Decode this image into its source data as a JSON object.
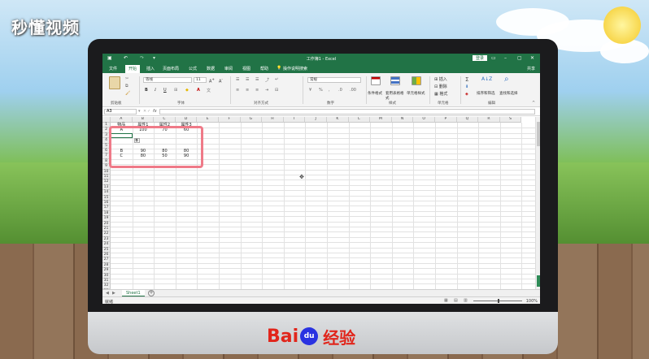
{
  "watermark": "秒懂视频",
  "brand": {
    "bai": "Bai",
    "du": "du",
    "jingyan": "经验"
  },
  "window": {
    "title": "工作簿1 - Excel",
    "login": "登录",
    "share": "共享"
  },
  "tabs": [
    {
      "label": "文件"
    },
    {
      "label": "开始",
      "active": true
    },
    {
      "label": "插入"
    },
    {
      "label": "页面布局"
    },
    {
      "label": "公式"
    },
    {
      "label": "数据"
    },
    {
      "label": "审阅"
    },
    {
      "label": "视图"
    },
    {
      "label": "帮助"
    },
    {
      "label": "操作说明搜索"
    }
  ],
  "ribbon": {
    "font_name": "等线",
    "font_size": "11",
    "number_format": "常规",
    "groups": {
      "clipboard": "剪贴板",
      "font": "字体",
      "alignment": "对齐方式",
      "number": "数字",
      "styles": "样式",
      "cells": "单元格",
      "editing": "编辑"
    },
    "buttons": {
      "conditional_format": "条件格式",
      "table_format": "套用表格格式",
      "cell_styles": "单元格样式",
      "insert": "插入",
      "delete": "删除",
      "format": "格式",
      "sort_filter": "排序和筛选",
      "find_select": "查找和选择"
    }
  },
  "formula_bar": {
    "name_box": "A3",
    "fx": "fx"
  },
  "columns": [
    "A",
    "B",
    "C",
    "D",
    "E",
    "F",
    "G",
    "H",
    "I",
    "J",
    "K",
    "L",
    "M",
    "N",
    "O",
    "P",
    "Q",
    "R",
    "S"
  ],
  "rows": [
    "1",
    "2",
    "3",
    "4",
    "5",
    "6",
    "7",
    "8",
    "9",
    "10",
    "11",
    "12",
    "13",
    "14",
    "15",
    "16",
    "17",
    "18",
    "19",
    "20",
    "21",
    "22",
    "23",
    "24",
    "25",
    "26",
    "27",
    "28",
    "29",
    "30",
    "31",
    "32",
    "33"
  ],
  "cells": {
    "r1": [
      "物品",
      "属性1",
      "属性2",
      "属性3"
    ],
    "r2": [
      "A",
      "100",
      "70",
      "60"
    ],
    "r6": [
      "B",
      "90",
      "80",
      "80"
    ],
    "r7": [
      "C",
      "80",
      "50",
      "90"
    ]
  },
  "sheet_tab": "Sheet1",
  "status": {
    "ready": "就绪",
    "zoom": "100%"
  }
}
